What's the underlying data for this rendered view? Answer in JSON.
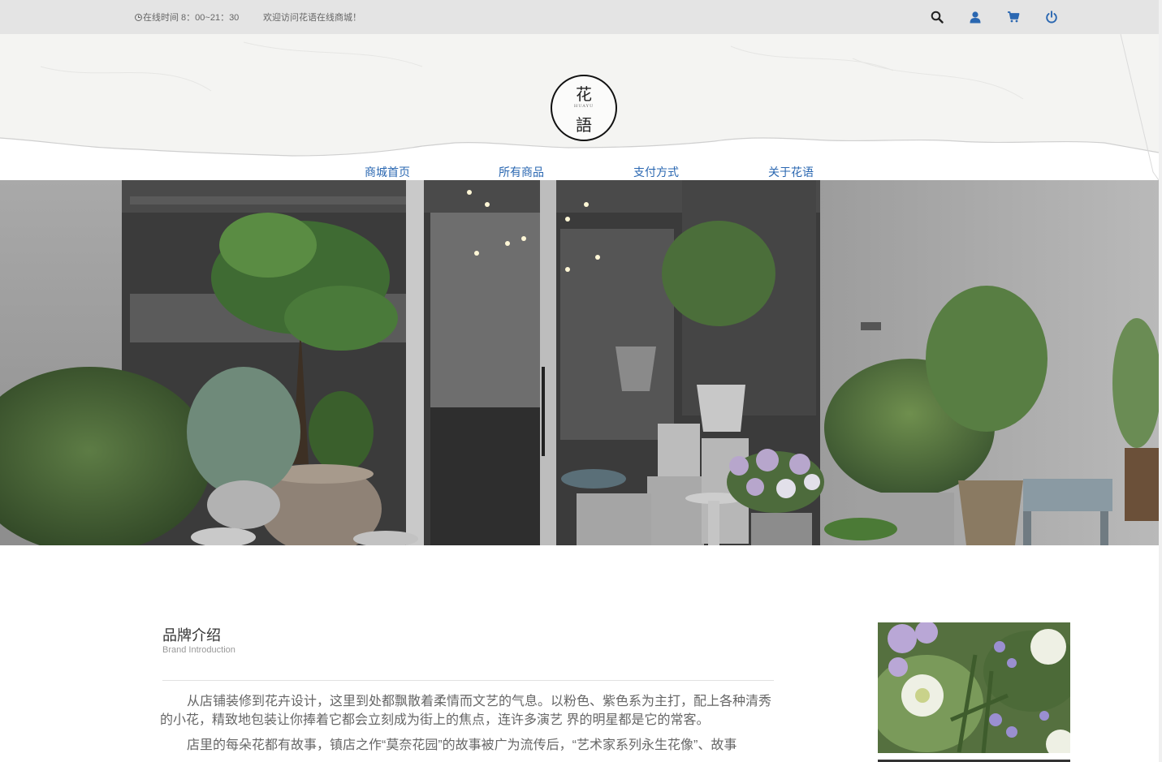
{
  "topbar": {
    "hours_text": "在线时间 8：00~21：30",
    "welcome_text": "欢迎访问花语在线商城！"
  },
  "icons": {
    "clock": "clock-icon",
    "search": "search-icon",
    "user": "user-icon",
    "cart": "cart-icon",
    "power": "power-icon"
  },
  "logo": {
    "char_top": "花",
    "small_text": "HUAYU",
    "char_bottom": "語"
  },
  "nav": [
    {
      "label": "商城首页"
    },
    {
      "label": "所有商品"
    },
    {
      "label": "支付方式"
    },
    {
      "label": "关于花语"
    }
  ],
  "brand": {
    "title": "品牌介绍",
    "subtitle": "Brand Introduction",
    "paragraphs": [
      "从店铺装修到花卉设计，这里到处都飘散着柔情而文艺的气息。以粉色、紫色系为主打，配上各种清秀的小花，精致地包装让你捧着它都会立刻成为街上的焦点，连许多演艺 界的明星都是它的常客。",
      "店里的每朵花都有故事，镇店之作“莫奈花园”的故事被广为流传后，“艺术家系列永生花像”、故事"
    ]
  },
  "colors": {
    "topbar_bg": "#e4e4e4",
    "nav_link": "#2a67b1",
    "icon_dark": "#222222",
    "icon_blue": "#2a67b1"
  }
}
